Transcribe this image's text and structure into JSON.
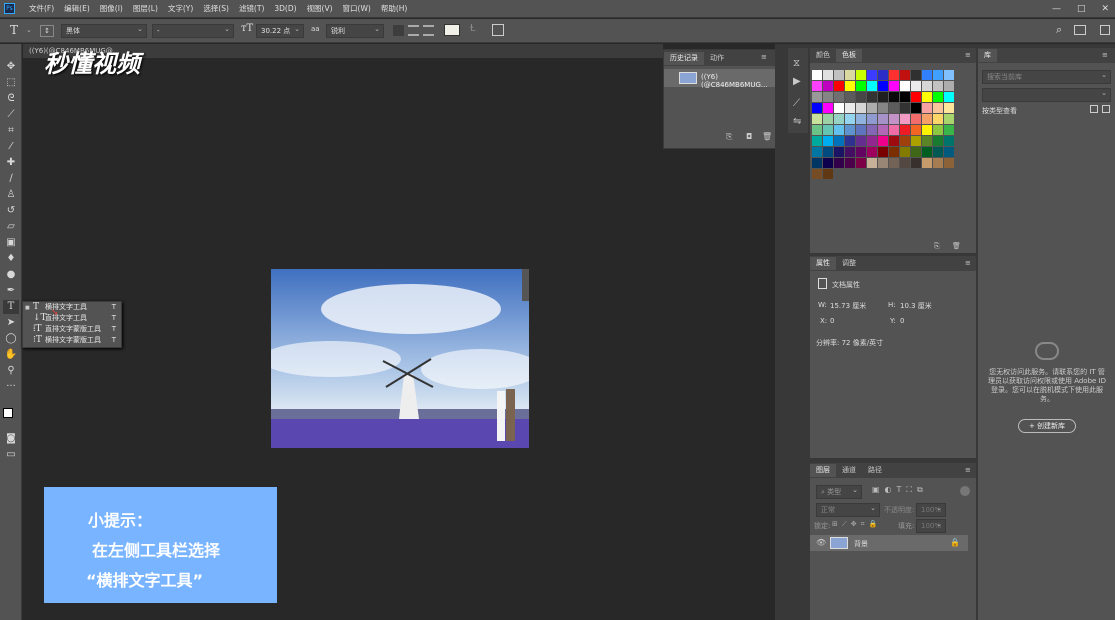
{
  "app": {
    "logo": "Ps"
  },
  "menu": [
    "文件(F)",
    "编辑(E)",
    "图像(I)",
    "图层(L)",
    "文字(Y)",
    "选择(S)",
    "滤镜(T)",
    "3D(D)",
    "视图(V)",
    "窗口(W)",
    "帮助(H)"
  ],
  "window": {
    "minimize": "—",
    "maximize": "□",
    "close": "✕"
  },
  "options": {
    "font_family": "黑体",
    "font_style": "-",
    "font_size": "30.22 点",
    "aa_prefix": "aa",
    "antialias": "锐利"
  },
  "doc": {
    "tab": "((Y6)(@C846MB6MUG@...",
    "watermark": "秒懂视频"
  },
  "flyout": {
    "items": [
      {
        "label": "横排文字工具",
        "key": "T"
      },
      {
        "label": "直排文字工具",
        "key": "T"
      },
      {
        "label": "直排文字蒙版工具",
        "key": "T"
      },
      {
        "label": "横排文字蒙版工具",
        "key": "T"
      }
    ]
  },
  "hint": {
    "line1": "小提示：",
    "line2": "在左侧工具栏选择",
    "line3": "“横排文字工具”"
  },
  "history": {
    "tab1": "历史记录",
    "tab2": "动作",
    "item": "((Y6)(@C846MB6MUG..."
  },
  "color": {
    "tab1": "颜色",
    "tab2": "色板"
  },
  "properties": {
    "tab1": "属性",
    "tab2": "调整",
    "title": "文档属性",
    "w_label": "W:",
    "w_value": "15.73 厘米",
    "h_label": "H:",
    "h_value": "10.3 厘米",
    "x_label": "X:",
    "x_value": "0",
    "y_label": "Y:",
    "y_value": "0",
    "resolution": "分辨率: 72 像素/英寸"
  },
  "layers": {
    "tab1": "图层",
    "tab2": "通道",
    "tab3": "路径",
    "filter": "类型",
    "blend": "正常",
    "opacity_label": "不透明度:",
    "opacity": "100%",
    "lock_label": "锁定:",
    "fill_label": "填充:",
    "fill": "100%",
    "layer_name": "背景"
  },
  "library": {
    "tab": "库",
    "search": "搜索当前库",
    "view": "按类型查看",
    "message": "您无权访问此服务。请联系您的 IT 管理员以获取访问权限或使用 Adobe ID 登录。您可以在脱机模式下使用此服务。",
    "create": "+ 创建新库"
  },
  "swatches": [
    "#ffffff",
    "#e0e0e0",
    "#c0c0c0",
    "#d9d9a0",
    "#c8ff00",
    "#3c3cff",
    "#2c2cc8",
    "#ff3030",
    "#c01010",
    "#303030",
    "#3080ff",
    "#40a0ff",
    "#80c0ff",
    "#ff40ff",
    "#c000c0",
    "#ff0000",
    "#ffff00",
    "#00ff00",
    "#00ffff",
    "#0000ff",
    "#ff00ff",
    "#ffffff",
    "#ebebeb",
    "#d6d6d6",
    "#c2c2c2",
    "#adadad",
    "#999999",
    "#858585",
    "#707070",
    "#5c5c5c",
    "#474747",
    "#333333",
    "#1f1f1f",
    "#0a0a0a",
    "#000000",
    "#ff0000",
    "#ffff00",
    "#00ff00",
    "#00ffff",
    "#0000ff",
    "#ff00ff",
    "#ffffff",
    "#ebebeb",
    "#d6d6d6",
    "#adadad",
    "#858585",
    "#5c5c5c",
    "#333333",
    "#000000",
    "#f7a1a1",
    "#f9c69c",
    "#fde69a",
    "#c6e29b",
    "#9bd1a4",
    "#96d3c5",
    "#94d4ee",
    "#8fb3de",
    "#8f9ad0",
    "#a692c8",
    "#c392c6",
    "#f29ac3",
    "#f26c6c",
    "#f6a168",
    "#fcd767",
    "#a8d66c",
    "#6cc388",
    "#65c4b2",
    "#62c1ec",
    "#5e93d0",
    "#5f73bf",
    "#8466b5",
    "#b266b5",
    "#ee6ba5",
    "#ed1c24",
    "#f26522",
    "#fff200",
    "#8dc63f",
    "#39b54a",
    "#00a99d",
    "#00aeef",
    "#0072bc",
    "#2e3192",
    "#662d91",
    "#92278f",
    "#ec008c",
    "#9e0b0f",
    "#a0410d",
    "#aba000",
    "#598527",
    "#197b30",
    "#00746b",
    "#0076a3",
    "#004a80",
    "#1b1464",
    "#440e62",
    "#630460",
    "#9e005d",
    "#790000",
    "#7b2e00",
    "#827b00",
    "#406618",
    "#005e20",
    "#005952",
    "#005b7f",
    "#003663",
    "#0d004c",
    "#32004b",
    "#4b0049",
    "#7b0046",
    "#c7b299",
    "#998675",
    "#736357",
    "#534741",
    "#37302d",
    "#c69c6d",
    "#a67c52",
    "#8c6239",
    "#754c24",
    "#603813"
  ]
}
